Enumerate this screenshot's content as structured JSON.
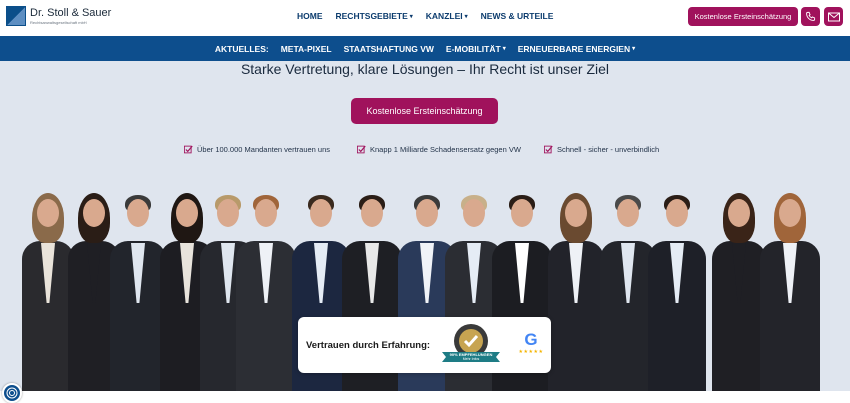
{
  "header": {
    "logo_name": "Dr. Stoll & Sauer",
    "logo_sub": "Rechtsanwaltsgesellschaft mbH",
    "nav": [
      {
        "label": "HOME",
        "caret": ""
      },
      {
        "label": "RECHTSGEBIETE",
        "caret": "▾"
      },
      {
        "label": "KANZLEI",
        "caret": "▾"
      },
      {
        "label": "NEWS & URTEILE",
        "caret": ""
      }
    ],
    "cta": "Kostenlose Ersteinschätzung",
    "phone_icon": "phone-icon",
    "mail_icon": "mail-icon"
  },
  "subnav": {
    "prefix": "AKTUELLES:",
    "items": [
      {
        "label": "META-PIXEL",
        "caret": ""
      },
      {
        "label": "STAATSHAFTUNG VW",
        "caret": ""
      },
      {
        "label": "E-MOBILITÄT",
        "caret": "▾"
      },
      {
        "label": "ERNEUERBARE ENERGIEN",
        "caret": "▾"
      }
    ]
  },
  "hero": {
    "headline": "Starke Vertretung, klare Lösungen – Ihr Recht ist unser Ziel",
    "cta": "Kostenlose Ersteinschätzung",
    "trust": [
      "Über 100.000 Mandanten vertrauen uns",
      "Knapp 1 Milliarde Schadensersatz gegen VW",
      "Schnell - sicher - unverbindlich"
    ]
  },
  "trust_card": {
    "label": "Vertrauen durch Erfahrung:",
    "badge_text": "90% EMPFEHLUNGEN",
    "badge_sub": "Mehr Infos",
    "google_letter": "G",
    "google_stars": "★★★★★"
  },
  "colors": {
    "brand_blue": "#0d4e8d",
    "accent": "#a0125c",
    "hero_bg": "#dfe5ee"
  },
  "fab_icon": "fingerprint-icon"
}
